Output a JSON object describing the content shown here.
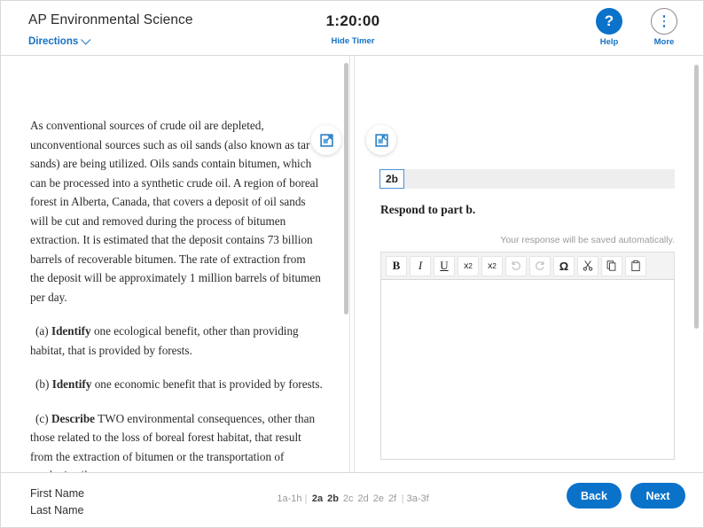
{
  "header": {
    "exam_title": "AP Environmental Science",
    "directions_label": "Directions",
    "timer": "1:20:00",
    "hide_timer_label": "Hide Timer",
    "help_label": "Help",
    "help_glyph": "?",
    "more_label": "More",
    "accent_color": "#0b72ca",
    "link_color": "#1471c4"
  },
  "panels": {
    "expand_left_icon": "expand-left-panel-icon",
    "expand_right_icon": "expand-right-panel-icon"
  },
  "passage": {
    "paragraphs": [
      {
        "indent": false,
        "html": "As conventional sources of crude oil are depleted, unconventional sources such as oil sands (also known as tar sands) are being utilized. Oils sands contain bitumen, which can be processed into a synthetic crude oil. A region of boreal forest in Alberta, Canada, that covers a deposit of oil sands will be cut and removed during the process of bitumen extraction. It is estimated that the deposit contains 73 billion barrels of recoverable bitumen. The rate of extraction from the deposit will be approximately 1 million barrels of bitumen per day."
      },
      {
        "indent": true,
        "html": "(a) <b>Identify</b> one ecological benefit, other than providing habitat, that is provided by forests."
      },
      {
        "indent": true,
        "html": "(b) <b>Identify</b> one economic benefit that is provided by forests."
      },
      {
        "indent": true,
        "html": "(c) <b>Describe</b> TWO environmental consequences, other than those related to the loss of boreal forest habitat, that result from the extraction of bitumen or the transportation of synthetic oil to customers."
      }
    ]
  },
  "question": {
    "tab_label": "2b",
    "prompt": "Respond to part b.",
    "save_note": "Your response will be saved automatically.",
    "response_value": "",
    "toolbar": [
      {
        "name": "bold-button",
        "label": "B",
        "kind": "bold"
      },
      {
        "name": "italic-button",
        "label": "I",
        "kind": "ital"
      },
      {
        "name": "underline-button",
        "label": "U",
        "kind": "undl"
      },
      {
        "name": "superscript-button",
        "label": "x2",
        "kind": "sup"
      },
      {
        "name": "subscript-button",
        "label": "x2",
        "kind": "sub"
      },
      {
        "name": "undo-button",
        "label": "",
        "kind": "undo"
      },
      {
        "name": "redo-button",
        "label": "",
        "kind": "redo"
      },
      {
        "name": "special-character-button",
        "label": "Ω",
        "kind": "om"
      },
      {
        "name": "cut-button",
        "label": "",
        "kind": "cut"
      },
      {
        "name": "copy-button",
        "label": "",
        "kind": "copy"
      },
      {
        "name": "paste-button",
        "label": "",
        "kind": "paste"
      }
    ]
  },
  "footer": {
    "first_name": "First Name",
    "last_name": "Last Name",
    "pager": {
      "group_before": "1a-1h",
      "separator": "|",
      "items": [
        {
          "label": "2a",
          "active": true
        },
        {
          "label": "2b",
          "active": true
        },
        {
          "label": "2c",
          "active": false
        },
        {
          "label": "2d",
          "active": false
        },
        {
          "label": "2e",
          "active": false
        },
        {
          "label": "2f",
          "active": false
        }
      ],
      "group_after": "3a-3f"
    },
    "back_label": "Back",
    "next_label": "Next"
  }
}
